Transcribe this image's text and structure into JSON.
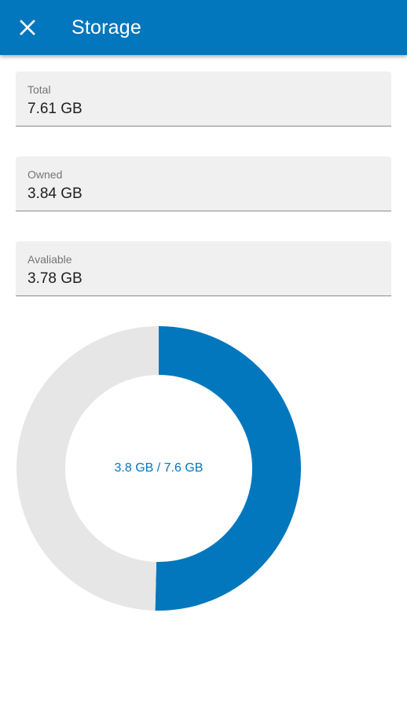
{
  "header": {
    "title": "Storage",
    "close_icon": "close-icon",
    "color": "#0277bd"
  },
  "fields": [
    {
      "label": "Total",
      "value": "7.61 GB"
    },
    {
      "label": "Owned",
      "value": "3.84 GB"
    },
    {
      "label": "Avaliable",
      "value": "3.78 GB"
    }
  ],
  "chart_data": {
    "type": "pie",
    "style": "donut",
    "center_label": "3.8 GB / 7.6 GB",
    "slices": [
      {
        "value": 3.84,
        "color": "#0277bd"
      },
      {
        "value": 3.78,
        "color": "#e6e6e6"
      }
    ],
    "start_angle": "top",
    "direction": "clockwise"
  }
}
